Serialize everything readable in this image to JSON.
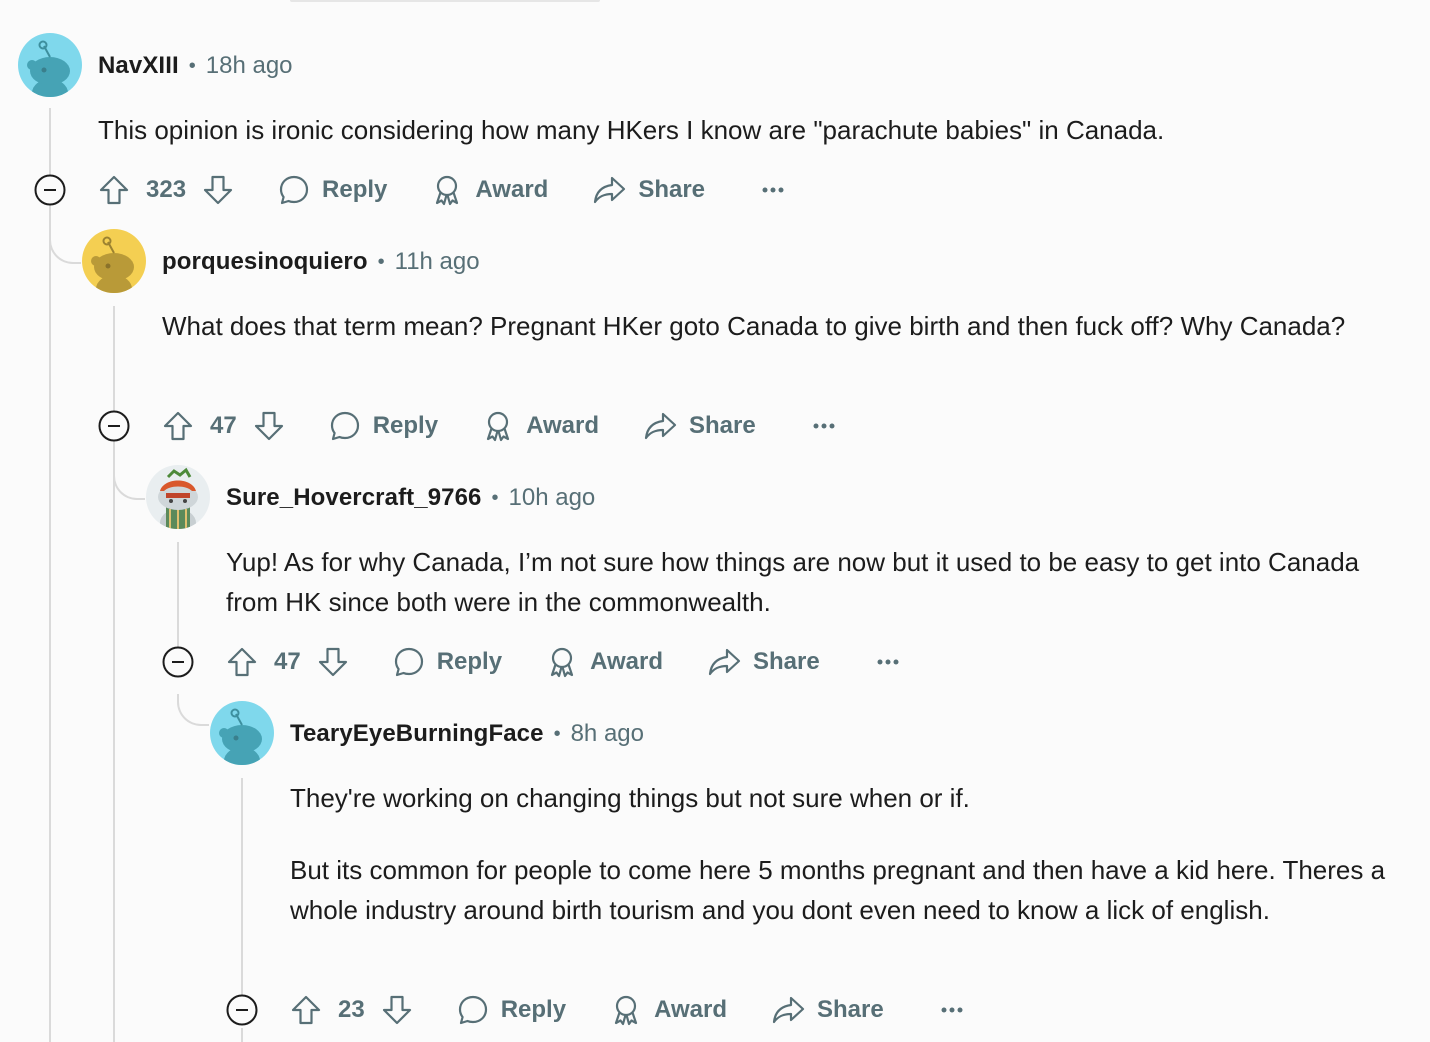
{
  "comments": [
    {
      "username": "NavXIII",
      "separator": "•",
      "time": "18h ago",
      "body": [
        "This opinion is ironic considering how many HKers I know are \"parachute babies\" in Canada."
      ],
      "votes": "323",
      "avatar_color": "#7fd8ec"
    },
    {
      "username": "porquesinoquiero",
      "separator": "•",
      "time": "11h ago",
      "body": [
        "What does that term mean? Pregnant HKer goto Canada to give birth and then fuck off? Why Canada?"
      ],
      "votes": "47",
      "avatar_color": "#f4cf52"
    },
    {
      "username": "Sure_Hovercraft_9766",
      "separator": "•",
      "time": "10h ago",
      "body": [
        "Yup! As for why Canada, I’m not sure how things are now but it used to be easy to get into Canada from HK since both were in the commonwealth."
      ],
      "votes": "47",
      "avatar_color": "#e9eef0"
    },
    {
      "username": "TearyEyeBurningFace",
      "separator": "•",
      "time": "8h ago",
      "body": [
        "They're working on changing things but not sure when or if.",
        "But its common for people to come here 5 months pregnant and then have a kid here. Theres a whole industry around birth tourism and you dont even need to know a lick of english."
      ],
      "votes": "23",
      "avatar_color": "#7fd8ec"
    }
  ],
  "actions": {
    "reply": "Reply",
    "award": "Award",
    "share": "Share",
    "more": "⋯"
  },
  "icons": {
    "collapse": "minus-circle-icon",
    "upvote": "arrow-up-icon",
    "downvote": "arrow-down-icon",
    "reply": "speech-bubble-icon",
    "award": "award-ribbon-icon",
    "share": "share-arrow-icon",
    "more": "ellipsis-icon"
  },
  "colors": {
    "text": "#1c1c1c",
    "muted": "#576f76",
    "thread_line": "#dadada",
    "background": "#fbfbfb"
  }
}
